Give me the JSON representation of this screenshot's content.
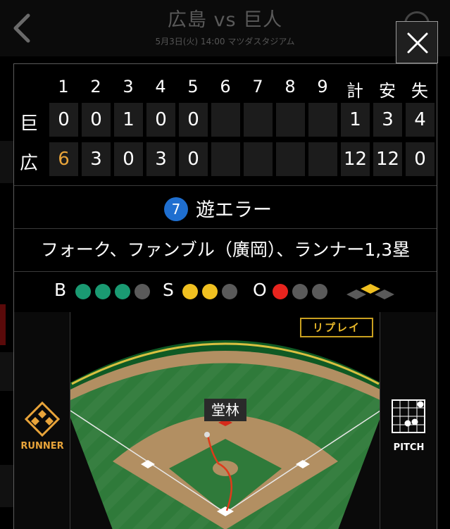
{
  "header": {
    "title": "広島 vs 巨人",
    "subtitle": "5月3日(火) 14:00 マツダスタジアム"
  },
  "scoreboard": {
    "innings": [
      "1",
      "2",
      "3",
      "4",
      "5",
      "6",
      "7",
      "8",
      "9"
    ],
    "totals_headers": [
      "計",
      "安",
      "失"
    ],
    "teams": [
      {
        "name": "巨",
        "innings": [
          "0",
          "0",
          "1",
          "0",
          "0",
          "",
          "",
          "",
          ""
        ],
        "totals": [
          "1",
          "3",
          "4"
        ]
      },
      {
        "name": "広",
        "innings": [
          "6",
          "3",
          "0",
          "3",
          "0",
          "",
          "",
          "",
          ""
        ],
        "totals": [
          "12",
          "12",
          "0"
        ]
      }
    ]
  },
  "play": {
    "number": "7",
    "result": "遊エラー",
    "description": "フォーク、ファンブル（廣岡）、ランナー1,3塁"
  },
  "count": {
    "ball_label": "B",
    "strike_label": "S",
    "out_label": "O",
    "balls": 3,
    "balls_max": 4,
    "strikes": 2,
    "strikes_max": 3,
    "outs": 1,
    "outs_max": 3,
    "runners_on": [
      "first",
      "third"
    ]
  },
  "field": {
    "replay_label": "リプレイ",
    "fielder_name": "堂林",
    "runner_label": "RUNNER",
    "pitch_label": "PITCH"
  },
  "colors": {
    "highlight": "#e8a43a",
    "ball": "#1a9a72",
    "strike": "#f0c020",
    "out": "#e8241e",
    "play_badge": "#1f6fd0"
  }
}
